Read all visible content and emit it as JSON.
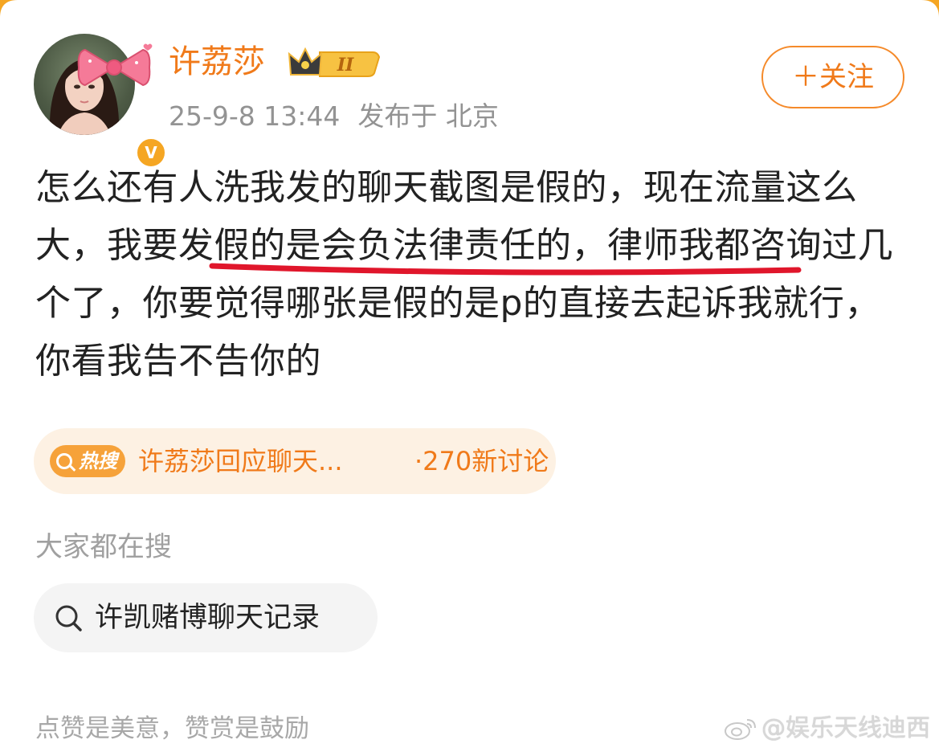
{
  "post": {
    "username": "许荔莎",
    "level_badge": "II",
    "verified_badge": "V",
    "timestamp": "25-9-8 13:44",
    "location": "发布于 北京",
    "follow_label": "＋关注",
    "text": "怎么还有人洗我发的聊天截图是假的，现在流量这么大，我要发假的是会负法律责任的，律师我都咨询过几个了，你要觉得哪张是假的是p的直接去起诉我就行，你看我告不告你的"
  },
  "hot_search": {
    "tag": "热搜",
    "topic": "许荔莎回应聊天...",
    "count": "·270新讨论"
  },
  "everyone_searching": {
    "label": "大家都在搜",
    "query": "许凯赌博聊天记录"
  },
  "footer": {
    "note": "点赞是美意，赞赏是鼓励",
    "watermark": "@娱乐天线迪西"
  },
  "colors": {
    "accent_orange": "#f07a1a",
    "hot_pill_bg": "#fdf1e3",
    "underline_red": "#e0162b",
    "gray_text": "#939393"
  }
}
